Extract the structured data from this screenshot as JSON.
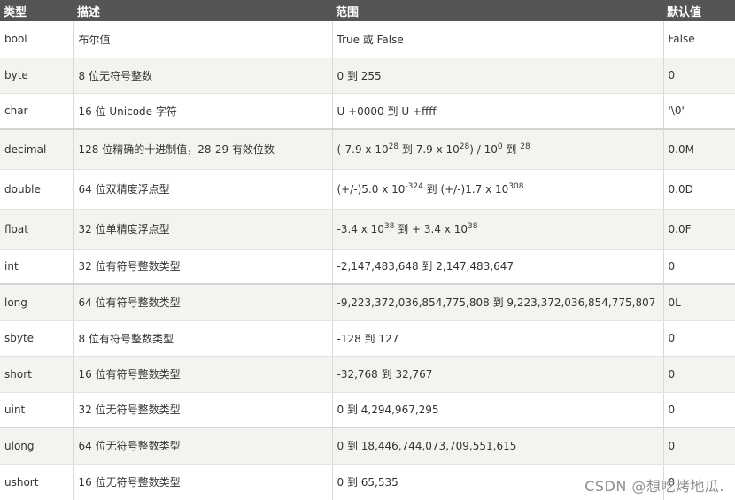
{
  "table": {
    "headers": [
      "类型",
      "描述",
      "范围",
      "默认值"
    ],
    "rows": [
      {
        "type": "bool",
        "desc": "布尔值",
        "range": "True 或 False",
        "default": "False"
      },
      {
        "type": "byte",
        "desc": "8 位无符号整数",
        "range": "0 到 255",
        "default": "0"
      },
      {
        "type": "char",
        "desc": "16 位 Unicode 字符",
        "range": "U +0000 到 U +ffff",
        "default": "'\\0'"
      },
      {
        "type": "decimal",
        "desc": "128 位精确的十进制值，28-29 有效位数",
        "range_parts": [
          "(-7.9 x 10",
          "28",
          " 到 7.9 x 10",
          "28",
          ") / 10",
          "0",
          " 到 ",
          "28"
        ],
        "default": "0.0M"
      },
      {
        "type": "double",
        "desc": "64 位双精度浮点型",
        "range_parts": [
          "(+/-)5.0 x 10",
          "-324",
          " 到 (+/-)1.7 x 10",
          "308"
        ],
        "default": "0.0D"
      },
      {
        "type": "float",
        "desc": "32 位单精度浮点型",
        "range_parts": [
          "-3.4 x 10",
          "38",
          " 到 + 3.4 x 10",
          "38"
        ],
        "default": "0.0F"
      },
      {
        "type": "int",
        "desc": "32 位有符号整数类型",
        "range": "-2,147,483,648 到 2,147,483,647",
        "default": "0"
      },
      {
        "type": "long",
        "desc": "64 位有符号整数类型",
        "range": "-9,223,372,036,854,775,808 到 9,223,372,036,854,775,807",
        "default": "0L"
      },
      {
        "type": "sbyte",
        "desc": "8 位有符号整数类型",
        "range": "-128 到 127",
        "default": "0"
      },
      {
        "type": "short",
        "desc": "16 位有符号整数类型",
        "range": "-32,768 到 32,767",
        "default": "0"
      },
      {
        "type": "uint",
        "desc": "32 位无符号整数类型",
        "range": "0 到 4,294,967,295",
        "default": "0"
      },
      {
        "type": "ulong",
        "desc": "64 位无符号整数类型",
        "range": "0 到 18,446,744,073,709,551,615",
        "default": "0"
      },
      {
        "type": "ushort",
        "desc": "16 位无符号整数类型",
        "range": "0 到 65,535",
        "default": "0"
      }
    ]
  },
  "watermark": "CSDN @想吃烤地瓜."
}
